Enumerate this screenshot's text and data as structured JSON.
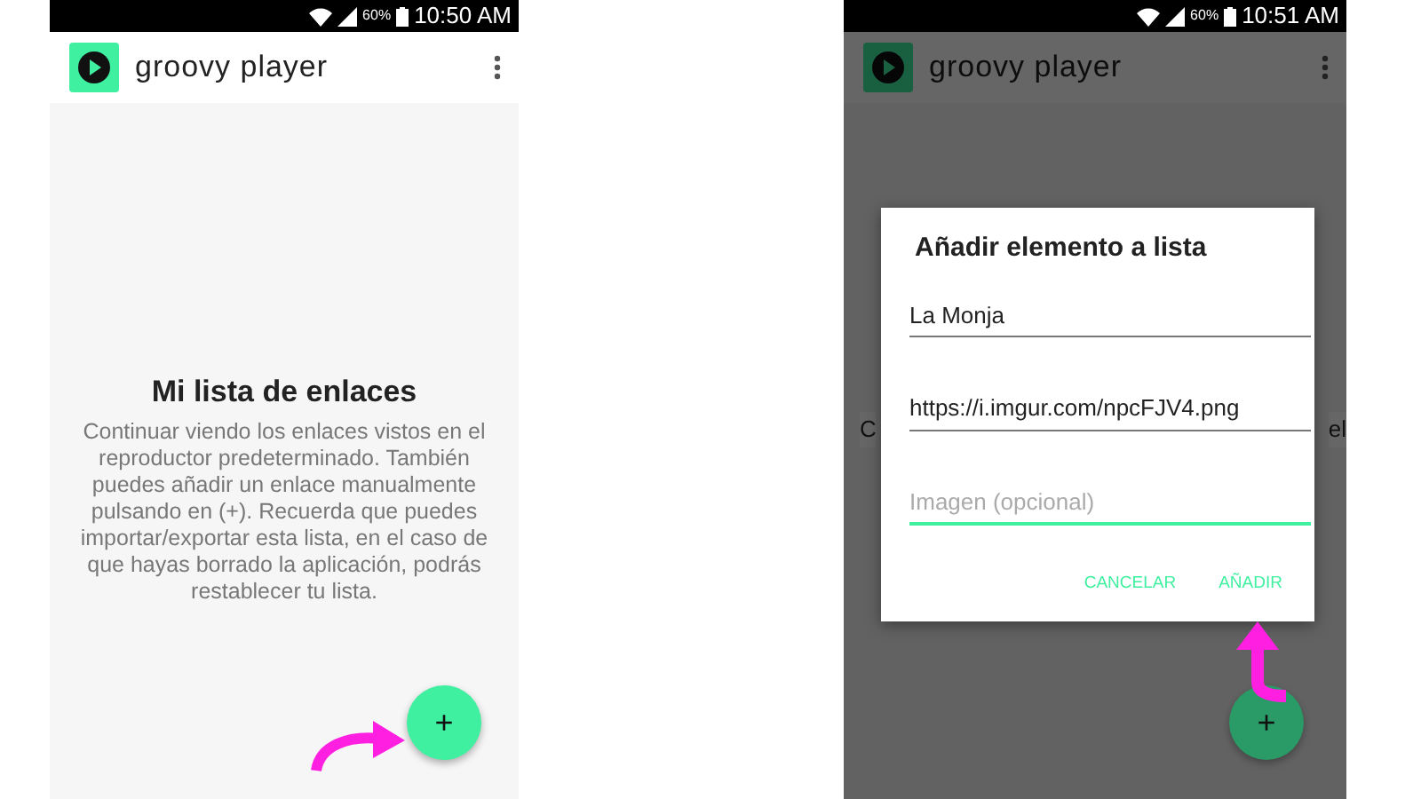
{
  "screens": [
    {
      "dimmed": false,
      "status_bar": {
        "battery": "60%",
        "time": "10:50 AM"
      },
      "app_bar": {
        "title": "groovy player"
      },
      "empty_state": {
        "title": "Mi lista de enlaces",
        "text": "Continuar viendo los enlaces vistos en el reproductor predeterminado. También puedes añadir un enlace manualmente pulsando en (+). Recuerda que puedes importar/exportar esta lista, en el caso de que hayas borrado la aplicación, podrás restablecer tu lista."
      },
      "fab": {
        "label": "+"
      }
    },
    {
      "dimmed": true,
      "status_bar": {
        "battery": "60%",
        "time": "10:51 AM"
      },
      "app_bar": {
        "title": "groovy player"
      },
      "background_fragments": [
        "C",
        "el"
      ],
      "fab": {
        "label": "+"
      },
      "dialog": {
        "title": "Añadir elemento a lista",
        "fields": [
          {
            "value": "La Monja",
            "focused": false
          },
          {
            "value": "https://i.imgur.com/npcFJV4.png",
            "focused": false
          },
          {
            "placeholder": "Imagen (opcional)",
            "focused": true
          }
        ],
        "buttons": [
          "CANCELAR",
          "AÑADIR"
        ]
      }
    }
  ]
}
